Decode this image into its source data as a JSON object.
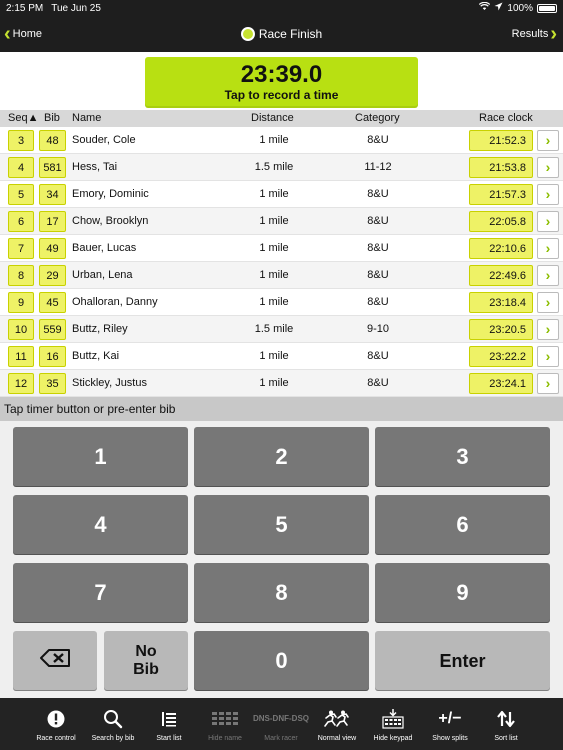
{
  "status": {
    "time": "2:15 PM",
    "date": "Tue Jun 25",
    "battery": "100%"
  },
  "nav": {
    "back": "Home",
    "title": "Race Finish",
    "next": "Results"
  },
  "timer": {
    "value": "23:39.0",
    "caption": "Tap to record a time"
  },
  "table": {
    "headers": {
      "seq": "Seq▲",
      "bib": "Bib",
      "name": "Name",
      "distance": "Distance",
      "category": "Category",
      "clock": "Race clock"
    },
    "rows": [
      {
        "seq": "3",
        "bib": "48",
        "name": "Souder, Cole",
        "distance": "1 mile",
        "category": "8&U",
        "clock": "21:52.3"
      },
      {
        "seq": "4",
        "bib": "581",
        "name": "Hess, Tai",
        "distance": "1.5 mile",
        "category": "11-12",
        "clock": "21:53.8"
      },
      {
        "seq": "5",
        "bib": "34",
        "name": "Emory, Dominic",
        "distance": "1 mile",
        "category": "8&U",
        "clock": "21:57.3"
      },
      {
        "seq": "6",
        "bib": "17",
        "name": "Chow, Brooklyn",
        "distance": "1 mile",
        "category": "8&U",
        "clock": "22:05.8"
      },
      {
        "seq": "7",
        "bib": "49",
        "name": "Bauer, Lucas",
        "distance": "1 mile",
        "category": "8&U",
        "clock": "22:10.6"
      },
      {
        "seq": "8",
        "bib": "29",
        "name": "Urban, Lena",
        "distance": "1 mile",
        "category": "8&U",
        "clock": "22:49.6"
      },
      {
        "seq": "9",
        "bib": "45",
        "name": "Ohalloran, Danny",
        "distance": "1 mile",
        "category": "8&U",
        "clock": "23:18.4"
      },
      {
        "seq": "10",
        "bib": "559",
        "name": "Buttz, Riley",
        "distance": "1.5 mile",
        "category": "9-10",
        "clock": "23:20.5"
      },
      {
        "seq": "11",
        "bib": "16",
        "name": "Buttz, Kai",
        "distance": "1 mile",
        "category": "8&U",
        "clock": "23:22.2"
      },
      {
        "seq": "12",
        "bib": "35",
        "name": "Stickley, Justus",
        "distance": "1 mile",
        "category": "8&U",
        "clock": "23:24.1"
      }
    ]
  },
  "hint": "Tap timer button or pre-enter bib",
  "keypad": {
    "digits": [
      "1",
      "2",
      "3",
      "4",
      "5",
      "6",
      "7",
      "8",
      "9"
    ],
    "zero": "0",
    "no_bib": [
      "No",
      "Bib"
    ],
    "enter": "Enter"
  },
  "toolbar": [
    {
      "label": "Race control",
      "icon": "alert-icon",
      "enabled": true
    },
    {
      "label": "Search by bib",
      "icon": "search-icon",
      "enabled": true
    },
    {
      "label": "Start list",
      "icon": "list-icon",
      "enabled": true
    },
    {
      "label": "Hide name",
      "icon": "grid-icon",
      "enabled": false
    },
    {
      "label": "Mark racer",
      "icon": "dns-icon",
      "enabled": false,
      "icon_text": "DNS-DNF-DSQ"
    },
    {
      "label": "Normal view",
      "icon": "runner-icon",
      "enabled": true
    },
    {
      "label": "Hide keypad",
      "icon": "keypad-icon",
      "enabled": true
    },
    {
      "label": "Show splits",
      "icon": "plus-minus-icon",
      "enabled": true,
      "icon_text": "+/−"
    },
    {
      "label": "Sort list",
      "icon": "sort-icon",
      "enabled": true
    }
  ],
  "colors": {
    "accent": "#b8e012",
    "pill": "#eef266",
    "key": "#777777",
    "key_light": "#b8b8b8",
    "bar": "#232323"
  }
}
